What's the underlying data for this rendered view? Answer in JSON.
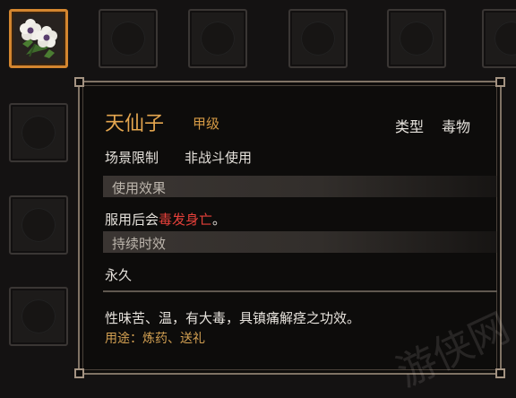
{
  "item": {
    "name": "天仙子",
    "grade": "甲级",
    "type_label": "类型",
    "type_value": "毒物",
    "scene_label": "场景限制",
    "scene_value": "非战斗使用",
    "effect_header": "使用效果",
    "effect_prefix": "服用后会",
    "effect_highlight": "毒发身亡",
    "effect_suffix": "。",
    "duration_header": "持续时效",
    "duration_value": "永久",
    "description": "性味苦、温，有大毒，具镇痛解痉之功效。",
    "usage": "用途：炼药、送礼"
  },
  "colors": {
    "name": "#e4a64f",
    "grade": "#d59a45",
    "highlight": "#e4403a",
    "selected_border": "#d4862f"
  },
  "icons": {
    "selected_item": "white-flower-icon"
  },
  "watermark": "游侠网"
}
